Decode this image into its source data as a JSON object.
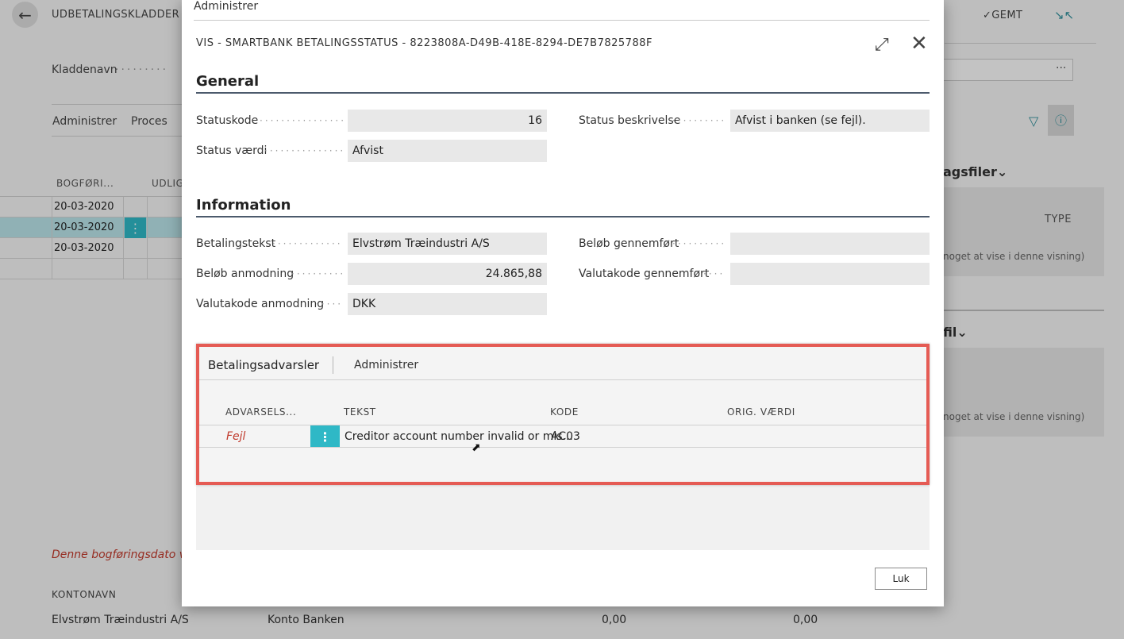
{
  "background": {
    "page_title": "UDBETALINGSKLADDER |",
    "saved_label": "GEMT",
    "kladde_label": "Kladdenavn",
    "menu": [
      "Administrer",
      "Proces"
    ],
    "columns": [
      "BOGFØRI...",
      "UDLIG"
    ],
    "rows": [
      "20-03-2020",
      "20-03-2020",
      "20-03-2020"
    ],
    "error_message": "Denne bogføringsdato vil i",
    "konto_header": "KONTONAVN",
    "bottom_row": {
      "name": "Elvstrøm Træindustri A/S",
      "account": "Konto Banken",
      "amount1": "0,00",
      "amount2": "0,00"
    },
    "factbox1": {
      "title": "agsfiler",
      "type_header": "TYPE",
      "empty_text": "noget at vise i denne visning)"
    },
    "factbox2": {
      "title": "fil",
      "empty_text": "noget at vise i denne visning)"
    }
  },
  "modal": {
    "top_action": "Administrer",
    "title": "VIS - SMARTBANK BETALINGSSTATUS - 8223808A-D49B-418E-8294-DE7B7825788F",
    "general": {
      "header": "General",
      "statuskode_label": "Statuskode",
      "statuskode_value": "16",
      "status_beskrivelse_label": "Status beskrivelse",
      "status_beskrivelse_value": "Afvist i banken (se fejl).",
      "status_vaerdi_label": "Status værdi",
      "status_vaerdi_value": "Afvist"
    },
    "information": {
      "header": "Information",
      "betalingstekst_label": "Betalingstekst",
      "betalingstekst_value": "Elvstrøm Træindustri A/S",
      "belob_gennemfort_label": "Beløb gennemført",
      "belob_gennemfort_value": "",
      "belob_anmodning_label": "Beløb anmodning",
      "belob_anmodning_value": "24.865,88",
      "valutakode_gennemfort_label": "Valutakode gennemført",
      "valutakode_gennemfort_value": "",
      "valutakode_anmodning_label": "Valutakode anmodning",
      "valutakode_anmodning_value": "DKK"
    },
    "warnings": {
      "tab_label": "Betalingsadvarsler",
      "action_label": "Administrer",
      "columns": [
        "ADVARSELS...",
        "TEKST",
        "KODE",
        "ORIG. VÆRDI"
      ],
      "rows": [
        {
          "type": "Fejl",
          "text": "Creditor account number invalid or mis...",
          "code": "AC03",
          "orig_value": ""
        }
      ]
    },
    "close_button": "Luk"
  },
  "colors": {
    "accent": "#2fb8c6",
    "highlight_border": "#e55b54",
    "error_text": "#c0392b"
  }
}
